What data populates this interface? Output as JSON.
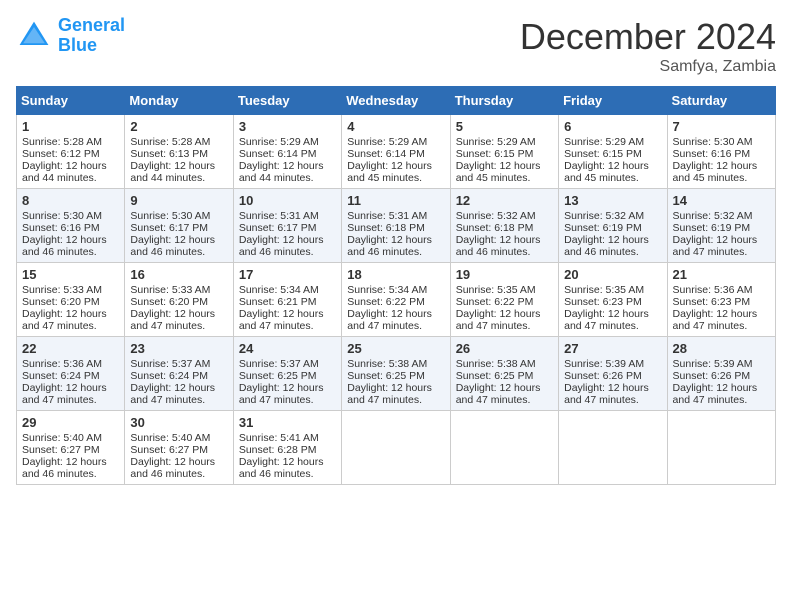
{
  "header": {
    "logo_line1": "General",
    "logo_line2": "Blue",
    "month": "December 2024",
    "location": "Samfya, Zambia"
  },
  "days_of_week": [
    "Sunday",
    "Monday",
    "Tuesday",
    "Wednesday",
    "Thursday",
    "Friday",
    "Saturday"
  ],
  "weeks": [
    [
      {
        "day": 1,
        "sunrise": "5:28 AM",
        "sunset": "6:12 PM",
        "daylight": "12 hours and 44 minutes."
      },
      {
        "day": 2,
        "sunrise": "5:28 AM",
        "sunset": "6:13 PM",
        "daylight": "12 hours and 44 minutes."
      },
      {
        "day": 3,
        "sunrise": "5:29 AM",
        "sunset": "6:14 PM",
        "daylight": "12 hours and 44 minutes."
      },
      {
        "day": 4,
        "sunrise": "5:29 AM",
        "sunset": "6:14 PM",
        "daylight": "12 hours and 45 minutes."
      },
      {
        "day": 5,
        "sunrise": "5:29 AM",
        "sunset": "6:15 PM",
        "daylight": "12 hours and 45 minutes."
      },
      {
        "day": 6,
        "sunrise": "5:29 AM",
        "sunset": "6:15 PM",
        "daylight": "12 hours and 45 minutes."
      },
      {
        "day": 7,
        "sunrise": "5:30 AM",
        "sunset": "6:16 PM",
        "daylight": "12 hours and 45 minutes."
      }
    ],
    [
      {
        "day": 8,
        "sunrise": "5:30 AM",
        "sunset": "6:16 PM",
        "daylight": "12 hours and 46 minutes."
      },
      {
        "day": 9,
        "sunrise": "5:30 AM",
        "sunset": "6:17 PM",
        "daylight": "12 hours and 46 minutes."
      },
      {
        "day": 10,
        "sunrise": "5:31 AM",
        "sunset": "6:17 PM",
        "daylight": "12 hours and 46 minutes."
      },
      {
        "day": 11,
        "sunrise": "5:31 AM",
        "sunset": "6:18 PM",
        "daylight": "12 hours and 46 minutes."
      },
      {
        "day": 12,
        "sunrise": "5:32 AM",
        "sunset": "6:18 PM",
        "daylight": "12 hours and 46 minutes."
      },
      {
        "day": 13,
        "sunrise": "5:32 AM",
        "sunset": "6:19 PM",
        "daylight": "12 hours and 46 minutes."
      },
      {
        "day": 14,
        "sunrise": "5:32 AM",
        "sunset": "6:19 PM",
        "daylight": "12 hours and 47 minutes."
      }
    ],
    [
      {
        "day": 15,
        "sunrise": "5:33 AM",
        "sunset": "6:20 PM",
        "daylight": "12 hours and 47 minutes."
      },
      {
        "day": 16,
        "sunrise": "5:33 AM",
        "sunset": "6:20 PM",
        "daylight": "12 hours and 47 minutes."
      },
      {
        "day": 17,
        "sunrise": "5:34 AM",
        "sunset": "6:21 PM",
        "daylight": "12 hours and 47 minutes."
      },
      {
        "day": 18,
        "sunrise": "5:34 AM",
        "sunset": "6:22 PM",
        "daylight": "12 hours and 47 minutes."
      },
      {
        "day": 19,
        "sunrise": "5:35 AM",
        "sunset": "6:22 PM",
        "daylight": "12 hours and 47 minutes."
      },
      {
        "day": 20,
        "sunrise": "5:35 AM",
        "sunset": "6:23 PM",
        "daylight": "12 hours and 47 minutes."
      },
      {
        "day": 21,
        "sunrise": "5:36 AM",
        "sunset": "6:23 PM",
        "daylight": "12 hours and 47 minutes."
      }
    ],
    [
      {
        "day": 22,
        "sunrise": "5:36 AM",
        "sunset": "6:24 PM",
        "daylight": "12 hours and 47 minutes."
      },
      {
        "day": 23,
        "sunrise": "5:37 AM",
        "sunset": "6:24 PM",
        "daylight": "12 hours and 47 minutes."
      },
      {
        "day": 24,
        "sunrise": "5:37 AM",
        "sunset": "6:25 PM",
        "daylight": "12 hours and 47 minutes."
      },
      {
        "day": 25,
        "sunrise": "5:38 AM",
        "sunset": "6:25 PM",
        "daylight": "12 hours and 47 minutes."
      },
      {
        "day": 26,
        "sunrise": "5:38 AM",
        "sunset": "6:25 PM",
        "daylight": "12 hours and 47 minutes."
      },
      {
        "day": 27,
        "sunrise": "5:39 AM",
        "sunset": "6:26 PM",
        "daylight": "12 hours and 47 minutes."
      },
      {
        "day": 28,
        "sunrise": "5:39 AM",
        "sunset": "6:26 PM",
        "daylight": "12 hours and 47 minutes."
      }
    ],
    [
      {
        "day": 29,
        "sunrise": "5:40 AM",
        "sunset": "6:27 PM",
        "daylight": "12 hours and 46 minutes."
      },
      {
        "day": 30,
        "sunrise": "5:40 AM",
        "sunset": "6:27 PM",
        "daylight": "12 hours and 46 minutes."
      },
      {
        "day": 31,
        "sunrise": "5:41 AM",
        "sunset": "6:28 PM",
        "daylight": "12 hours and 46 minutes."
      },
      null,
      null,
      null,
      null
    ]
  ]
}
